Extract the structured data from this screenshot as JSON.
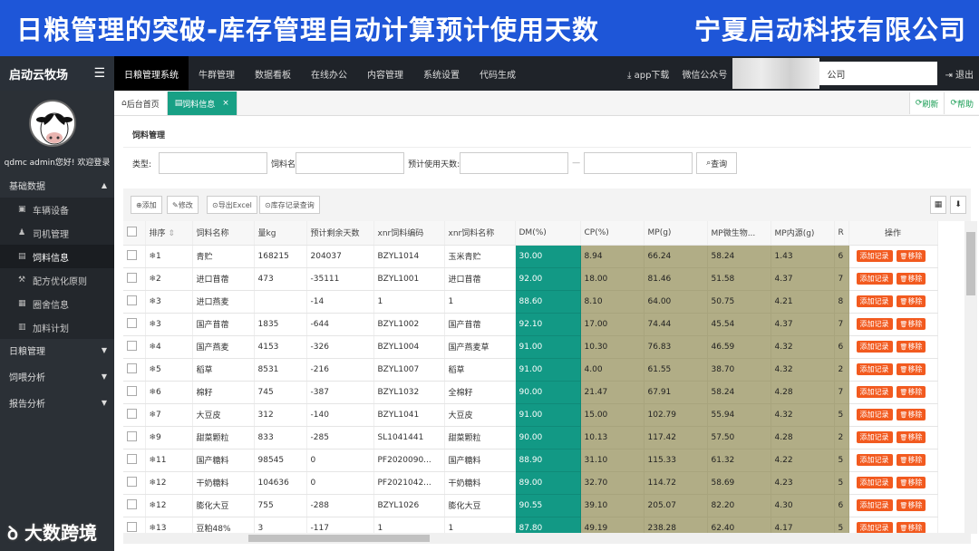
{
  "banner": {
    "title": "日粮管理的突破-库存管理自动计算预计使用天数",
    "company": "宁夏启动科技有限公司"
  },
  "topbar": {
    "brand": "启动云牧场",
    "nav": [
      "日粮管理系统",
      "牛群管理",
      "数据看板",
      "在线办公",
      "内容管理",
      "系统设置",
      "代码生成"
    ],
    "app_download": "app下载",
    "wechat": "微信公众号",
    "company_select": "公司",
    "logout": "退出"
  },
  "sidebar": {
    "welcome": "qdmc admin您好! 欢迎登录",
    "group1": "基础数据",
    "items": [
      {
        "icon": "▣",
        "label": "车辆设备"
      },
      {
        "icon": "♟",
        "label": "司机管理"
      },
      {
        "icon": "▤",
        "label": "饲料信息"
      },
      {
        "icon": "⚒",
        "label": "配方优化原则"
      },
      {
        "icon": "▦",
        "label": "圈舍信息"
      },
      {
        "icon": "▥",
        "label": "加料计划"
      }
    ],
    "groups": [
      "日粮管理",
      "饲喂分析",
      "报告分析"
    ]
  },
  "tabs": {
    "home": "后台首页",
    "current": "饲料信息",
    "refresh": "刷新",
    "help": "帮助"
  },
  "section": {
    "title": "饲料管理"
  },
  "filters": {
    "type_label": "类型:",
    "name_label": "饲料名",
    "days_label": "预计使用天数:",
    "search": "查询"
  },
  "toolbar": {
    "add": "添加",
    "edit": "修改",
    "export": "导出Excel",
    "history": "库存记录查询"
  },
  "table": {
    "headers": [
      "",
      "排序",
      "饲料名称",
      "量kg",
      "预计剩余天数",
      "xnr饲料编码",
      "xnr饲料名称",
      "DM(%)",
      "CP(%)",
      "MP(g)",
      "MP微生物...",
      "MP内源(g)",
      "R",
      "操作"
    ],
    "rows": [
      [
        "1",
        "青贮",
        "168215",
        "204037",
        "BZYL1014",
        "玉米青贮",
        "30.00",
        "8.94",
        "66.24",
        "58.24",
        "1.43",
        "6"
      ],
      [
        "2",
        "进口苜蓿",
        "473",
        "-35111",
        "BZYL1001",
        "进口苜蓿",
        "92.00",
        "18.00",
        "81.46",
        "51.58",
        "4.37",
        "7"
      ],
      [
        "3",
        "进口燕麦",
        "",
        "-14",
        "1",
        "1",
        "88.60",
        "8.10",
        "64.00",
        "50.75",
        "4.21",
        "8"
      ],
      [
        "3",
        "国产苜蓿",
        "1835",
        "-644",
        "BZYL1002",
        "国产苜蓿",
        "92.10",
        "17.00",
        "74.44",
        "45.54",
        "4.37",
        "7"
      ],
      [
        "4",
        "国产燕麦",
        "4153",
        "-326",
        "BZYL1004",
        "国产燕麦草",
        "91.00",
        "10.30",
        "76.83",
        "46.59",
        "4.32",
        "6"
      ],
      [
        "5",
        "稻草",
        "8531",
        "-216",
        "BZYL1007",
        "稻草",
        "91.00",
        "4.00",
        "61.55",
        "38.70",
        "4.32",
        "2"
      ],
      [
        "6",
        "棉籽",
        "745",
        "-387",
        "BZYL1032",
        "全棉籽",
        "90.00",
        "21.47",
        "67.91",
        "58.24",
        "4.28",
        "7"
      ],
      [
        "7",
        "大豆皮",
        "312",
        "-140",
        "BZYL1041",
        "大豆皮",
        "91.00",
        "15.00",
        "102.79",
        "55.94",
        "4.32",
        "5"
      ],
      [
        "9",
        "甜菜颗粒",
        "833",
        "-285",
        "SL1041441",
        "甜菜颗粒",
        "90.00",
        "10.13",
        "117.42",
        "57.50",
        "4.28",
        "2"
      ],
      [
        "11",
        "国产糖料",
        "98545",
        "0",
        "PF2020090...",
        "国产糖料",
        "88.90",
        "31.10",
        "115.33",
        "61.32",
        "4.22",
        "5"
      ],
      [
        "12",
        "干奶糖料",
        "104636",
        "0",
        "PF2021042...",
        "干奶糖料",
        "89.00",
        "32.70",
        "114.72",
        "58.69",
        "4.23",
        "5"
      ],
      [
        "12",
        "膨化大豆",
        "755",
        "-288",
        "BZYL1026",
        "膨化大豆",
        "90.55",
        "39.10",
        "205.07",
        "82.20",
        "4.30",
        "6"
      ],
      [
        "13",
        "豆粕48%",
        "3",
        "-117",
        "1",
        "1",
        "87.80",
        "49.19",
        "238.28",
        "62.40",
        "4.17",
        "5"
      ]
    ],
    "add_record": "添加记录",
    "remove": "移除"
  },
  "watermark": "大数跨境"
}
